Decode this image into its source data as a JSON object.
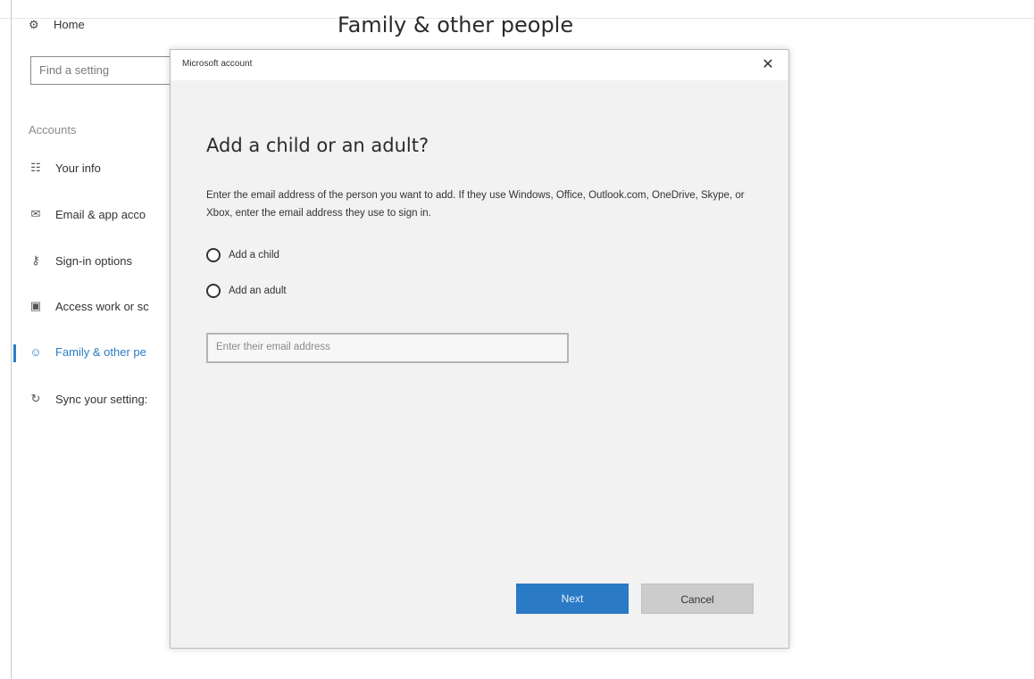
{
  "header": {
    "page_title": "Family & other people"
  },
  "sidebar": {
    "home_label": "Home",
    "search_placeholder": "Find a setting",
    "section_label": "Accounts",
    "items": [
      {
        "icon": "person-card-icon",
        "glyph": "☷",
        "label": "Your info"
      },
      {
        "icon": "mail-icon",
        "glyph": "✉",
        "label": "Email & app acco"
      },
      {
        "icon": "key-icon",
        "glyph": "⚷",
        "label": "Sign-in options"
      },
      {
        "icon": "briefcase-icon",
        "glyph": "▣",
        "label": "Access work or sc"
      },
      {
        "icon": "people-icon",
        "glyph": "☺",
        "label": "Family & other pe"
      },
      {
        "icon": "sync-icon",
        "glyph": "↻",
        "label": "Sync your setting:"
      }
    ]
  },
  "dialog": {
    "title": "Microsoft account",
    "close_glyph": "✕",
    "heading": "Add a child or an adult?",
    "description": "Enter the email address of the person you want to add. If they use Windows, Office, Outlook.com, OneDrive, Skype, or Xbox, enter the email address they use to sign in.",
    "options": [
      {
        "label": "Add a child",
        "selected": false
      },
      {
        "label": "Add an adult",
        "selected": false
      }
    ],
    "email_placeholder": "Enter their email address",
    "next_label": "Next",
    "cancel_label": "Cancel"
  },
  "colors": {
    "accent": "#2a7ac6",
    "dialog_bg": "#f2f2f2",
    "cancel_bg": "#cccccc"
  }
}
